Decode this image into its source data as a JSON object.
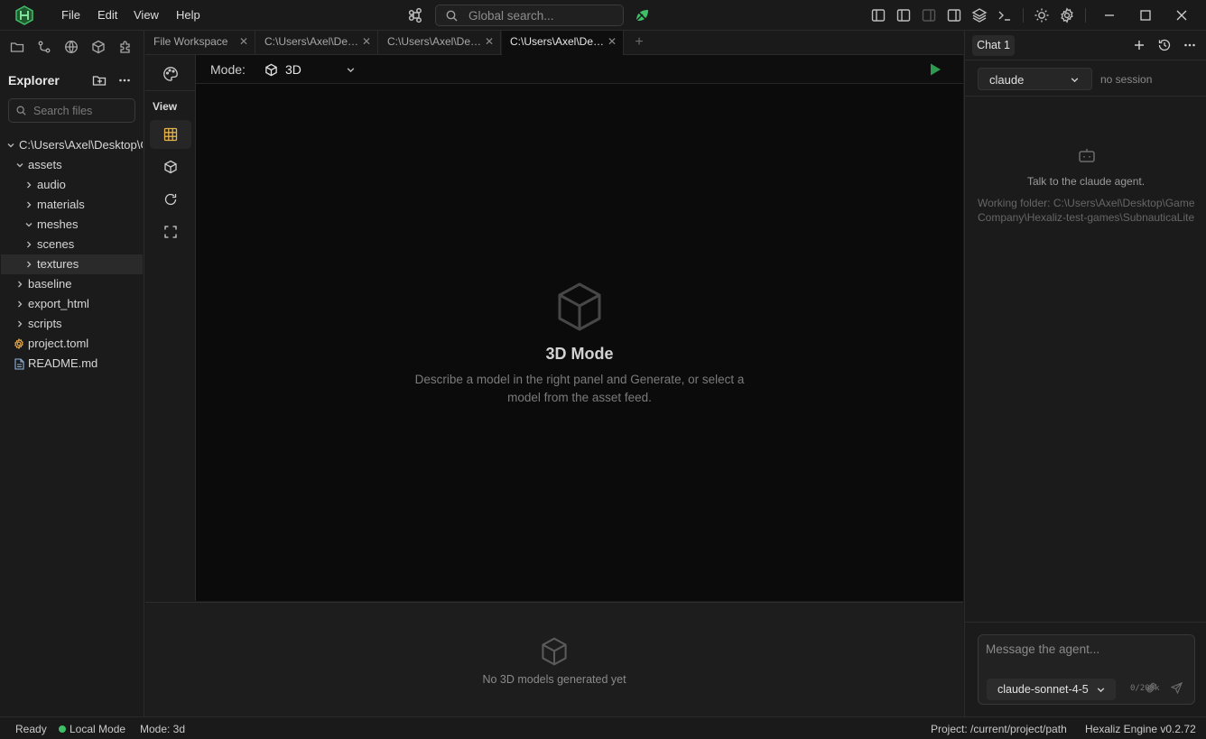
{
  "colors": {
    "accent_green": "#3fbf68",
    "background": "#1b1b1b",
    "viewport": "#0b0b0b"
  },
  "menu": {
    "file": "File",
    "edit": "Edit",
    "view": "View",
    "help": "Help"
  },
  "global_search": {
    "placeholder": "Global search..."
  },
  "toolbar_icons": [
    "command-icon",
    "leaf-icon",
    "panel-left-icon",
    "panel-split-icon",
    "panel-inactive-icon",
    "panel-right-icon",
    "layers-icon",
    "terminal-icon",
    "sun-icon",
    "gear-icon"
  ],
  "window_controls": [
    "minimize",
    "maximize",
    "close"
  ],
  "explorer": {
    "title": "Explorer",
    "search_placeholder": "Search files",
    "root": "C:\\Users\\Axel\\Desktop\\Game Company\\Hexaliz-test-games\\SubnauticaLite",
    "items": [
      {
        "label": "assets",
        "type": "folder",
        "expanded": true,
        "depth": 1
      },
      {
        "label": "audio",
        "type": "folder",
        "expanded": false,
        "depth": 2
      },
      {
        "label": "materials",
        "type": "folder",
        "expanded": false,
        "depth": 2
      },
      {
        "label": "meshes",
        "type": "folder",
        "expanded": true,
        "depth": 2
      },
      {
        "label": "scenes",
        "type": "folder",
        "expanded": false,
        "depth": 2
      },
      {
        "label": "textures",
        "type": "folder",
        "expanded": false,
        "depth": 2,
        "selected": true
      },
      {
        "label": "baseline",
        "type": "folder",
        "expanded": false,
        "depth": 1
      },
      {
        "label": "export_html",
        "type": "folder",
        "expanded": false,
        "depth": 1
      },
      {
        "label": "scripts",
        "type": "folder",
        "expanded": false,
        "depth": 1
      },
      {
        "label": "project.toml",
        "type": "config-file",
        "depth": 1
      },
      {
        "label": "README.md",
        "type": "markdown-file",
        "depth": 1
      }
    ]
  },
  "tabs": [
    {
      "label": "File Workspace",
      "active": false
    },
    {
      "label": "C:\\Users\\Axel\\Desktop\\Game Company",
      "active": false
    },
    {
      "label": "C:\\Users\\Axel\\Desktop\\Game Company",
      "active": false
    },
    {
      "label": "C:\\Users\\Axel\\Desktop\\Game Company",
      "active": true
    }
  ],
  "view_panel": {
    "title": "View",
    "tools": [
      "grid-icon",
      "cube-icon",
      "refresh-icon",
      "fullscreen-icon"
    ]
  },
  "mode_bar": {
    "label": "Mode:",
    "value": "3D"
  },
  "viewport": {
    "title": "3D Mode",
    "description": "Describe a model in the right panel and Generate, or select a model from the asset feed."
  },
  "asset_feed": {
    "empty_text": "No 3D models generated yet"
  },
  "chat": {
    "tab": "Chat 1",
    "agent": "claude",
    "session": "no session",
    "empty_title": "Talk to the claude agent.",
    "working_folder": "Working folder: C:\\Users\\Axel\\Desktop\\Game Company\\Hexaliz-test-games\\SubnauticaLite",
    "input_placeholder": "Message the agent...",
    "model": "claude-sonnet-4-5",
    "char_counter": "0/200k"
  },
  "status_bar": {
    "state": "Ready",
    "connection": "Local Mode",
    "mode": "Mode: 3d",
    "project": "Project: /current/project/path",
    "version": "Hexaliz Engine v0.2.72"
  }
}
